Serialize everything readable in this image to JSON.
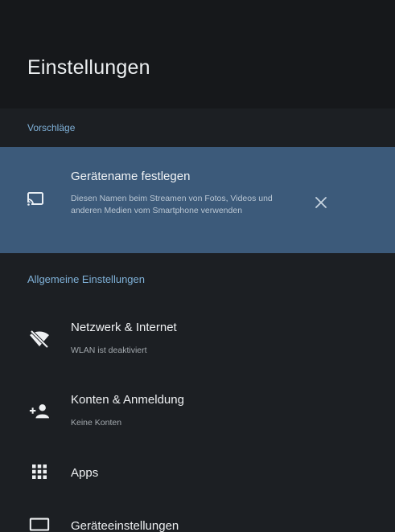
{
  "header": {
    "title": "Einstellungen"
  },
  "suggestions": {
    "section_label": "Vorschläge",
    "card": {
      "title": "Gerätename festlegen",
      "description": "Diesen Namen beim Streamen von Fotos, Videos und anderen Medien vom Smartphone verwenden",
      "icon": "cast-icon",
      "dismiss_icon": "close-icon"
    }
  },
  "general": {
    "section_label": "Allgemeine Einstellungen",
    "items": [
      {
        "label": "Netzwerk & Internet",
        "sub": "WLAN ist deaktiviert",
        "icon": "wifi-off-icon"
      },
      {
        "label": "Konten & Anmeldung",
        "sub": "Keine Konten",
        "icon": "add-account-icon"
      },
      {
        "label": "Apps",
        "icon": "apps-grid-icon"
      },
      {
        "label": "Geräteeinstellungen",
        "icon": "tv-icon"
      }
    ]
  },
  "colors": {
    "background": "#1c1f23",
    "header_background": "#16181b",
    "suggestion_card": "#3c5a7a",
    "accent_text": "#7fb1d8"
  }
}
